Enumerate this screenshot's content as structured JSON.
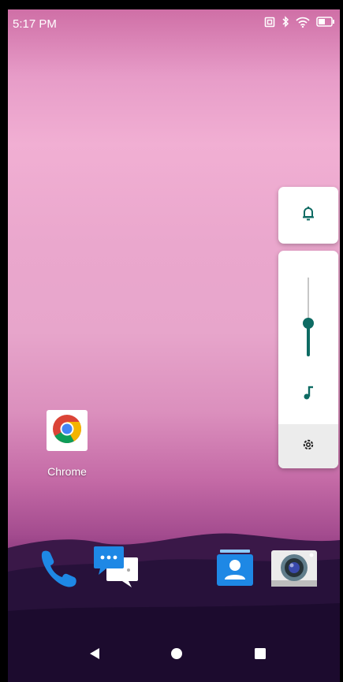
{
  "status_bar": {
    "time": "5:17 PM",
    "icons": [
      "vibrate-icon",
      "bluetooth-icon",
      "wifi-icon",
      "battery-icon"
    ]
  },
  "volume_dialog": {
    "ringer_icon": "bell-icon",
    "media_icon": "music-note-icon",
    "settings_icon": "gear-icon",
    "media_volume_fraction": 0.42,
    "accent_color": "#0e6b63"
  },
  "home": {
    "apps": [
      {
        "label": "Chrome",
        "icon": "chrome-icon"
      }
    ],
    "dock": [
      "phone-icon",
      "messages-icon",
      "contacts-icon",
      "camera-icon"
    ]
  },
  "nav_bar": {
    "buttons": [
      "back-icon",
      "home-icon",
      "recents-icon"
    ]
  }
}
